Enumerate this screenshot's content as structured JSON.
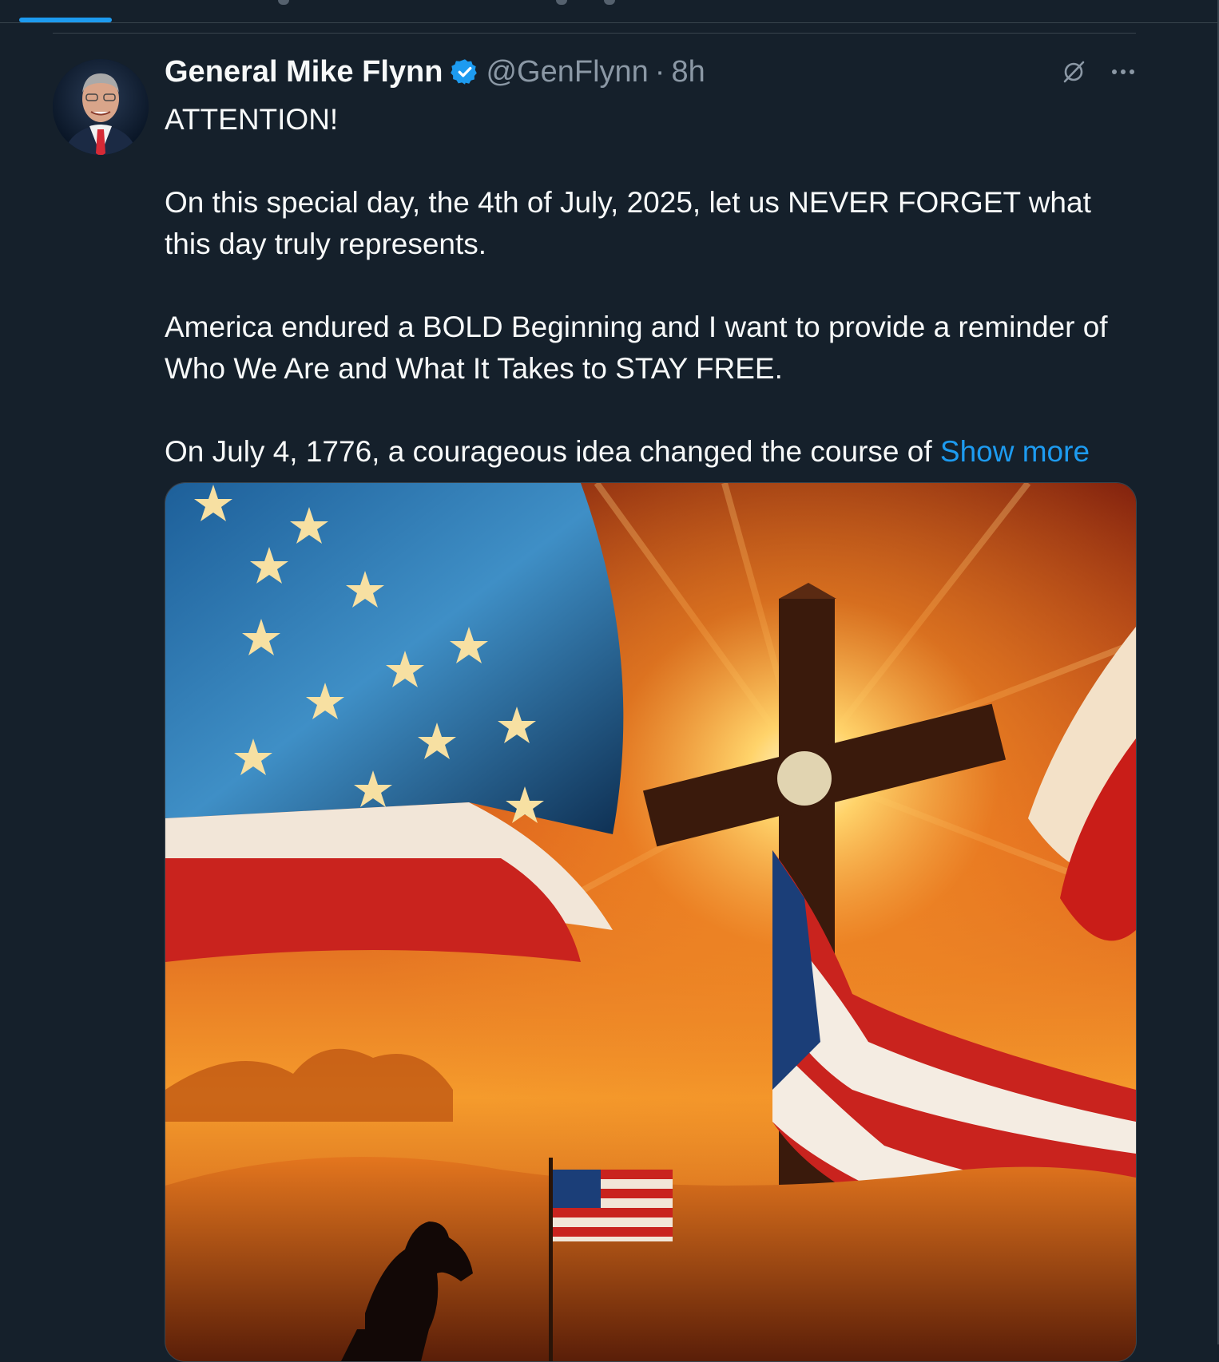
{
  "tweet": {
    "author_name": "General Mike Flynn",
    "handle": "@GenFlynn",
    "separator": "·",
    "time": "8h",
    "verified": true,
    "paragraphs": [
      "ATTENTION!",
      "On this special day, the 4th of July, 2025, let us NEVER FORGET what this day truly represents.",
      "America endured a BOLD Beginning and I want to provide a reminder of Who We Are and What It Takes to STAY FREE.",
      "On July 4, 1776, a courageous idea changed the course of"
    ],
    "show_more_label": "Show more"
  },
  "icons": {
    "grok": "grok-icon",
    "more": "more-options-icon",
    "verified": "verified-badge-icon"
  },
  "colors": {
    "background": "#15202b",
    "accent": "#1d9bf0",
    "muted_text": "#8b98a5",
    "border": "#38444d"
  }
}
